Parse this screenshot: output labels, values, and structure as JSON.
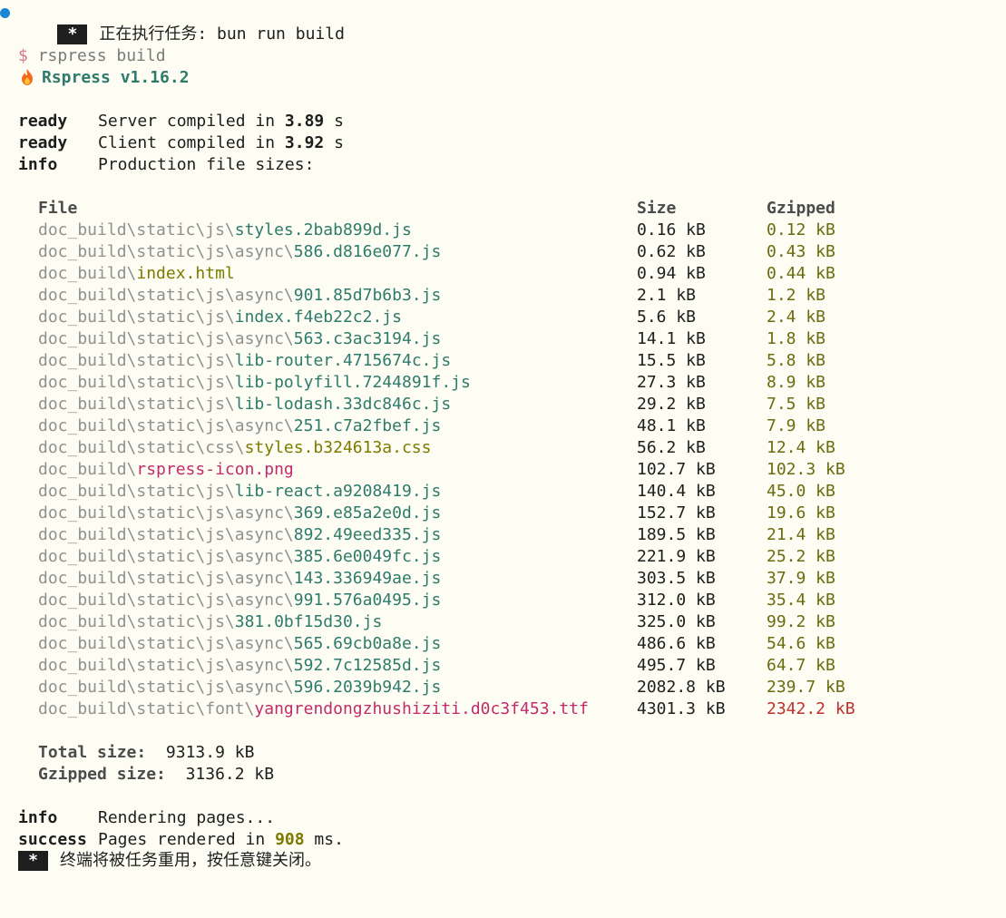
{
  "task_header": {
    "badge": "*",
    "text": "正在执行任务: bun run build"
  },
  "command": {
    "prompt": "$",
    "text": "rspress build"
  },
  "brand": {
    "name": "Rspress v1.16.2",
    "icon": "fire-icon"
  },
  "logs": [
    {
      "level": "ready",
      "prefix": "Server compiled in ",
      "value": "3.89",
      "suffix": " s"
    },
    {
      "level": "ready",
      "prefix": "Client compiled in ",
      "value": "3.92",
      "suffix": " s"
    },
    {
      "level": "info",
      "prefix": "Production file sizes:",
      "value": "",
      "suffix": ""
    }
  ],
  "table": {
    "headers": {
      "file": "File",
      "size": "Size",
      "gzipped": "Gzipped"
    },
    "rows": [
      {
        "dir": "doc_build\\static\\js\\",
        "name": "styles.2bab899d.js",
        "kind": "js",
        "size": "0.16 kB",
        "gzipped": "0.12 kB"
      },
      {
        "dir": "doc_build\\static\\js\\async\\",
        "name": "586.d816e077.js",
        "kind": "js",
        "size": "0.62 kB",
        "gzipped": "0.43 kB"
      },
      {
        "dir": "doc_build\\",
        "name": "index.html",
        "kind": "html",
        "size": "0.94 kB",
        "gzipped": "0.44 kB"
      },
      {
        "dir": "doc_build\\static\\js\\async\\",
        "name": "901.85d7b6b3.js",
        "kind": "js",
        "size": "2.1 kB",
        "gzipped": "1.2 kB"
      },
      {
        "dir": "doc_build\\static\\js\\",
        "name": "index.f4eb22c2.js",
        "kind": "js",
        "size": "5.6 kB",
        "gzipped": "2.4 kB"
      },
      {
        "dir": "doc_build\\static\\js\\async\\",
        "name": "563.c3ac3194.js",
        "kind": "js",
        "size": "14.1 kB",
        "gzipped": "1.8 kB"
      },
      {
        "dir": "doc_build\\static\\js\\",
        "name": "lib-router.4715674c.js",
        "kind": "js",
        "size": "15.5 kB",
        "gzipped": "5.8 kB"
      },
      {
        "dir": "doc_build\\static\\js\\",
        "name": "lib-polyfill.7244891f.js",
        "kind": "js",
        "size": "27.3 kB",
        "gzipped": "8.9 kB"
      },
      {
        "dir": "doc_build\\static\\js\\",
        "name": "lib-lodash.33dc846c.js",
        "kind": "js",
        "size": "29.2 kB",
        "gzipped": "7.5 kB"
      },
      {
        "dir": "doc_build\\static\\js\\async\\",
        "name": "251.c7a2fbef.js",
        "kind": "js",
        "size": "48.1 kB",
        "gzipped": "7.9 kB"
      },
      {
        "dir": "doc_build\\static\\css\\",
        "name": "styles.b324613a.css",
        "kind": "css",
        "size": "56.2 kB",
        "gzipped": "12.4 kB"
      },
      {
        "dir": "doc_build\\",
        "name": "rspress-icon.png",
        "kind": "png",
        "size": "102.7 kB",
        "gzipped": "102.3 kB"
      },
      {
        "dir": "doc_build\\static\\js\\",
        "name": "lib-react.a9208419.js",
        "kind": "js",
        "size": "140.4 kB",
        "gzipped": "45.0 kB"
      },
      {
        "dir": "doc_build\\static\\js\\async\\",
        "name": "369.e85a2e0d.js",
        "kind": "js",
        "size": "152.7 kB",
        "gzipped": "19.6 kB"
      },
      {
        "dir": "doc_build\\static\\js\\async\\",
        "name": "892.49eed335.js",
        "kind": "js",
        "size": "189.5 kB",
        "gzipped": "21.4 kB"
      },
      {
        "dir": "doc_build\\static\\js\\async\\",
        "name": "385.6e0049fc.js",
        "kind": "js",
        "size": "221.9 kB",
        "gzipped": "25.2 kB"
      },
      {
        "dir": "doc_build\\static\\js\\async\\",
        "name": "143.336949ae.js",
        "kind": "js",
        "size": "303.5 kB",
        "gzipped": "37.9 kB"
      },
      {
        "dir": "doc_build\\static\\js\\async\\",
        "name": "991.576a0495.js",
        "kind": "js",
        "size": "312.0 kB",
        "gzipped": "35.4 kB"
      },
      {
        "dir": "doc_build\\static\\js\\",
        "name": "381.0bf15d30.js",
        "kind": "js",
        "size": "325.0 kB",
        "gzipped": "99.2 kB"
      },
      {
        "dir": "doc_build\\static\\js\\async\\",
        "name": "565.69cb0a8e.js",
        "kind": "js",
        "size": "486.6 kB",
        "gzipped": "54.6 kB"
      },
      {
        "dir": "doc_build\\static\\js\\async\\",
        "name": "592.7c12585d.js",
        "kind": "js",
        "size": "495.7 kB",
        "gzipped": "64.7 kB"
      },
      {
        "dir": "doc_build\\static\\js\\async\\",
        "name": "596.2039b942.js",
        "kind": "js",
        "size": "2082.8 kB",
        "gzipped": "239.7 kB"
      },
      {
        "dir": "doc_build\\static\\font\\",
        "name": "yangrendongzhushiziti.d0c3f453.ttf",
        "kind": "ttf",
        "size": "4301.3 kB",
        "gzipped": "2342.2 kB",
        "gz_large": true
      }
    ]
  },
  "totals": {
    "total_label": "Total size:",
    "total_value": "9313.9 kB",
    "gzipped_label": "Gzipped size:",
    "gzipped_value": "3136.2 kB"
  },
  "render_logs": [
    {
      "level": "info",
      "prefix": "Rendering pages...",
      "value": "",
      "suffix": ""
    },
    {
      "level": "success",
      "prefix": "Pages rendered in ",
      "value": "908",
      "suffix": " ms."
    }
  ],
  "task_footer": {
    "badge": "*",
    "text": "终端将被任务重用，按任意键关闭。"
  },
  "colors": {
    "background": "#fdfdf3",
    "accent_dot": "#1a85d6",
    "filename_js": "#2e7a6d",
    "filename_html_css": "#7d7a00",
    "filename_asset": "#c12b6d",
    "gzip_normal": "#6b6b10",
    "gzip_large": "#c03030"
  }
}
